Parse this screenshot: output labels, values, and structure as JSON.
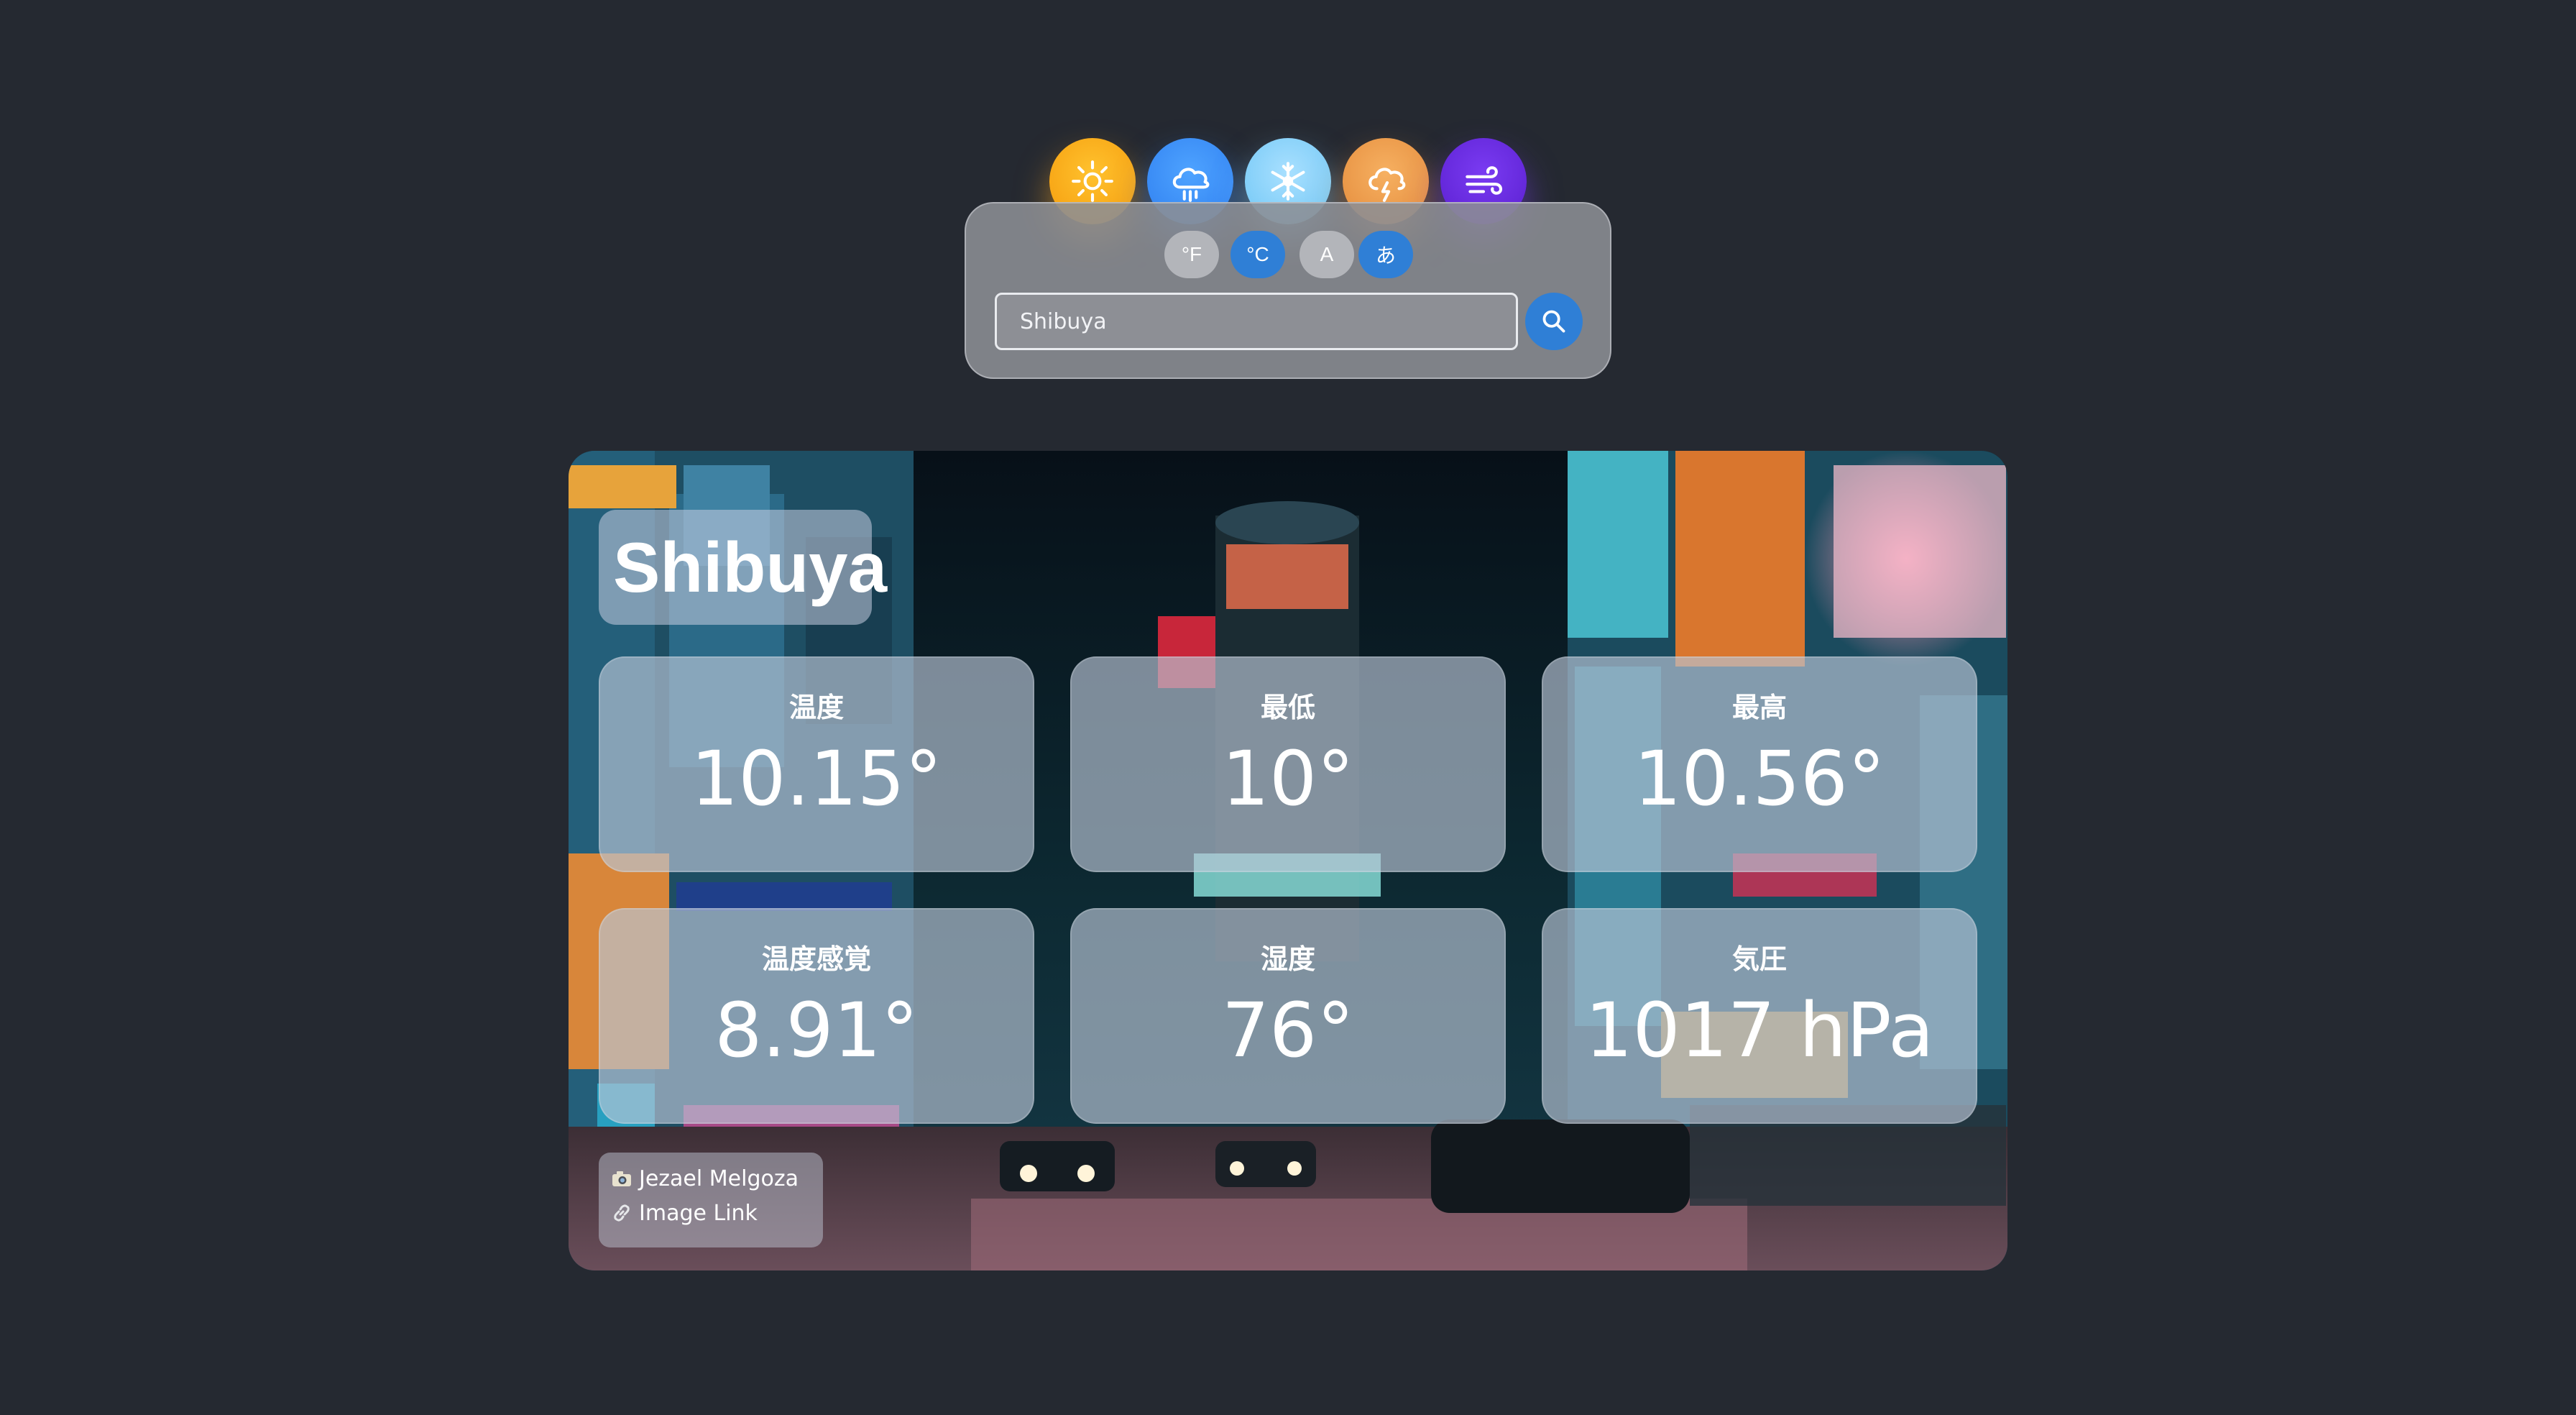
{
  "weather_icons": [
    "sun-icon",
    "cloud-rain-icon",
    "snowflake-icon",
    "cloud-lightning-icon",
    "wind-icon"
  ],
  "colors": {
    "page_background": "#252931",
    "accent_blue": "#2f7fd6",
    "sunny": "#f8a81a",
    "rain": "#3b8df7",
    "snow": "#8ed4fa",
    "storm": "#ec9a4c",
    "wind": "#6a2ce0"
  },
  "settings": {
    "fahrenheit_label": "°F",
    "celsius_label": "°C",
    "english_label": "A",
    "japanese_label": "あ",
    "selected_unit": "°C",
    "selected_language": "あ"
  },
  "search": {
    "value": "Shibuya",
    "button_icon": "search-icon"
  },
  "weather": {
    "city": "Shibuya",
    "stats": [
      {
        "label": "温度",
        "value": "10.15°"
      },
      {
        "label": "最低",
        "value": "10°"
      },
      {
        "label": "最高",
        "value": "10.56°"
      },
      {
        "label": "温度感覚",
        "value": "8.91°"
      },
      {
        "label": "湿度",
        "value": "76°"
      },
      {
        "label": "気圧",
        "value": "1017 hPa"
      }
    ]
  },
  "photo_credit": {
    "author": "Jezael Melgoza",
    "author_icon": "camera-icon",
    "link_label": "Image Link",
    "link_icon": "link-icon"
  }
}
